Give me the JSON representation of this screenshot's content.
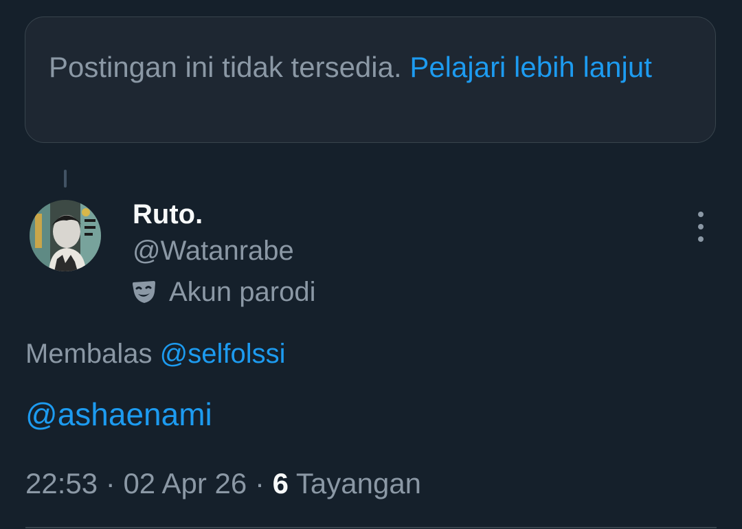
{
  "notice": {
    "text": "Postingan ini tidak tersedia.",
    "link_text": "Pelajari lebih lanjut"
  },
  "tweet": {
    "author": {
      "display_name": "Ruto.",
      "handle": "@Watanrabe",
      "label_icon": "theater-masks-icon",
      "label": "Akun parodi"
    },
    "reply_prefix": "Membalas",
    "reply_to": "@selfolssi",
    "text_mention": "@ashaenami",
    "time": "22:53",
    "date": "02 Apr 26",
    "separator": "·",
    "views_count": "6",
    "views_label": "Tayangan"
  },
  "colors": {
    "background": "#15202b",
    "card_background": "#1e2732",
    "border": "#38444d",
    "accent_link": "#1d9bf0",
    "secondary_text": "#8b98a5",
    "primary_text": "#f7f9f9"
  }
}
